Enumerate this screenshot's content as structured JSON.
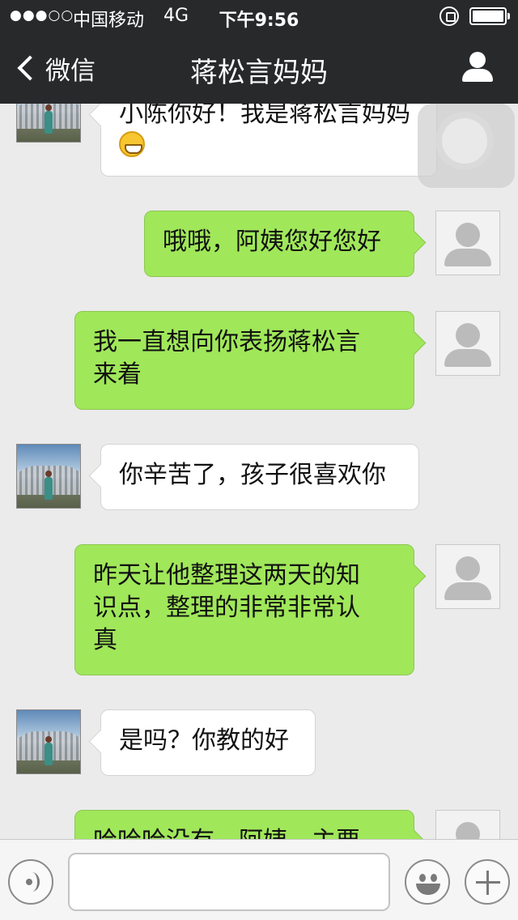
{
  "status_bar": {
    "signal": "●●●○○",
    "carrier": "中国移动",
    "network": "4G",
    "time": "下午9:56"
  },
  "nav": {
    "back_label": "微信",
    "title": "蒋松言妈妈"
  },
  "messages": [
    {
      "from": "contact",
      "avatar_icon": "photo-avatar",
      "text": "小陈你好！我是蒋松言妈妈",
      "emoji": "grinning-face-icon"
    },
    {
      "from": "me",
      "avatar_icon": "default-avatar",
      "text": "哦哦，阿姨您好您好"
    },
    {
      "from": "me",
      "avatar_icon": "default-avatar",
      "lines": [
        "我一直想向你表扬蒋松言",
        "来着"
      ]
    },
    {
      "from": "contact",
      "avatar_icon": "photo-avatar",
      "text": "你辛苦了，孩子很喜欢你"
    },
    {
      "from": "me",
      "avatar_icon": "default-avatar",
      "lines": [
        "昨天让他整理这两天的知",
        "识点，整理的非常非常认",
        "真"
      ]
    },
    {
      "from": "contact",
      "avatar_icon": "photo-avatar",
      "text": "是吗？你教的好"
    },
    {
      "from": "me",
      "avatar_icon": "default-avatar",
      "text": "哈哈哈没有，阿姨，主要"
    }
  ],
  "input_bar": {
    "message_value": "",
    "icons": [
      "voice-icon",
      "emoji-icon",
      "plus-icon"
    ]
  }
}
